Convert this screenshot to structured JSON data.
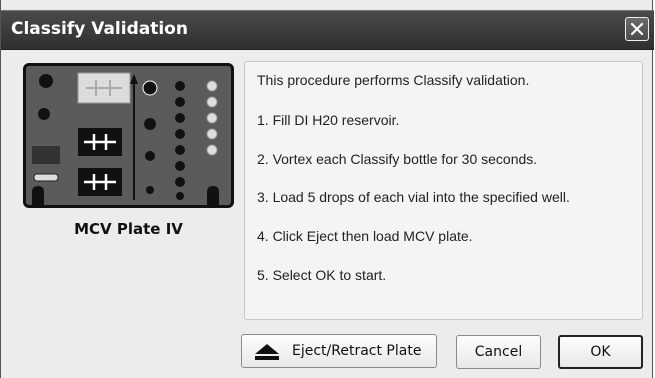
{
  "window": {
    "title": "Classify Validation",
    "close_icon": "close-icon"
  },
  "plate": {
    "caption": "MCV Plate IV",
    "image_icon": "mcv-plate-diagram"
  },
  "instructions": {
    "intro": "This procedure performs Classify validation.",
    "steps": [
      "1. Fill DI H20 reservoir.",
      "2. Vortex each Classify bottle for 30 seconds.",
      "3. Load 5 drops of each vial into the specified well.",
      "4. Click Eject then load MCV plate.",
      "5. Select OK to start."
    ]
  },
  "buttons": {
    "eject_label": "Eject/Retract Plate",
    "eject_icon": "eject-icon",
    "cancel_label": "Cancel",
    "ok_label": "OK"
  }
}
